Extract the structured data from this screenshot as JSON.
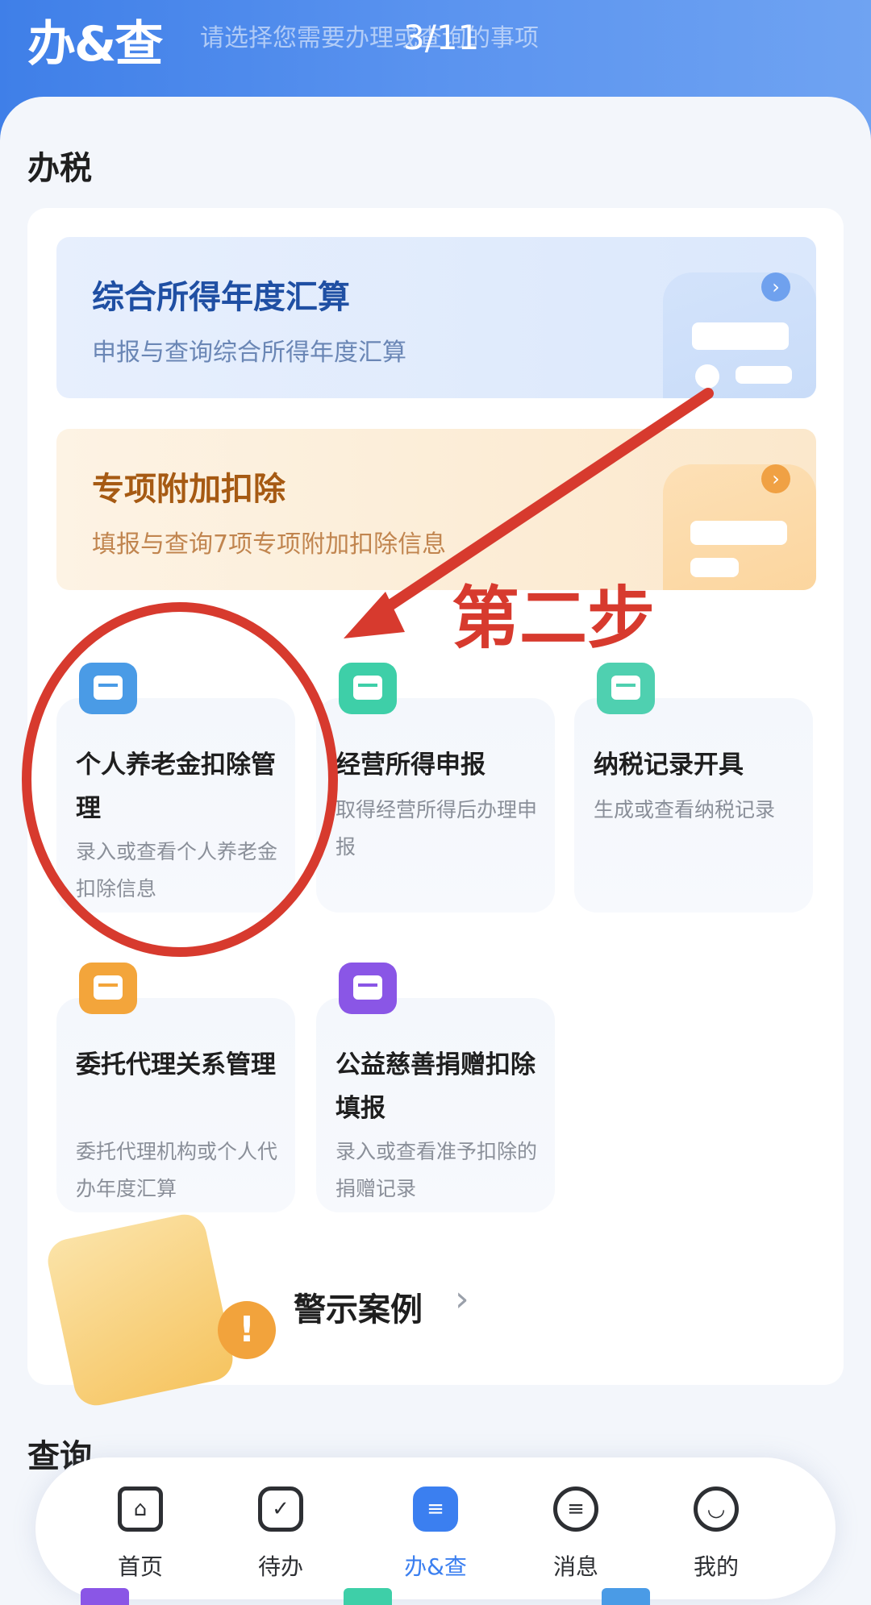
{
  "header": {
    "brand": "办&查",
    "subtitle": "请选择您需要办理或查询的事项",
    "pager": "3/11"
  },
  "sections": {
    "tax": "办税",
    "query": "查询"
  },
  "banners": [
    {
      "title": "综合所得年度汇算",
      "subtitle": "申报与查询综合所得年度汇算",
      "arrow": "›",
      "accent": "#1f4fa3"
    },
    {
      "title": "专项附加扣除",
      "subtitle": "填报与查询7项专项附加扣除信息",
      "arrow": "›",
      "accent": "#a65a13"
    }
  ],
  "tiles": [
    {
      "title": "个人养老金扣除管理",
      "desc": "录入或查看个人养老金扣除信息",
      "icon": "pension-card-icon",
      "color": "#4a9be6"
    },
    {
      "title": "经营所得申报",
      "desc": "取得经营所得后办理申报",
      "icon": "business-form-icon",
      "color": "#3ecfa8"
    },
    {
      "title": "纳税记录开具",
      "desc": "生成或查看纳税记录",
      "icon": "tax-record-icon",
      "color": "#4fd0b0"
    },
    {
      "title": "委托代理关系管理",
      "desc": "委托代理机构或个人代办年度汇算",
      "icon": "agent-hand-icon",
      "color": "#f3a53b"
    },
    {
      "title": "公益慈善捐赠扣除填报",
      "desc": "录入或查看准予扣除的捐赠记录",
      "icon": "charity-heart-icon",
      "color": "#8a56e6"
    }
  ],
  "warning": {
    "label": "警示案例",
    "arrow": "›",
    "badge": "!"
  },
  "annotation": {
    "text": "第二步",
    "color": "#d73a2e"
  },
  "tabbar": [
    {
      "label": "首页",
      "icon": "home-icon",
      "mark": "⌂"
    },
    {
      "label": "待办",
      "icon": "calendar-check-icon",
      "mark": "✓"
    },
    {
      "label": "办&查",
      "icon": "handle-query-icon",
      "mark": "≡",
      "active": true
    },
    {
      "label": "消息",
      "icon": "message-icon",
      "mark": "≡"
    },
    {
      "label": "我的",
      "icon": "smile-icon",
      "mark": "◡"
    }
  ]
}
